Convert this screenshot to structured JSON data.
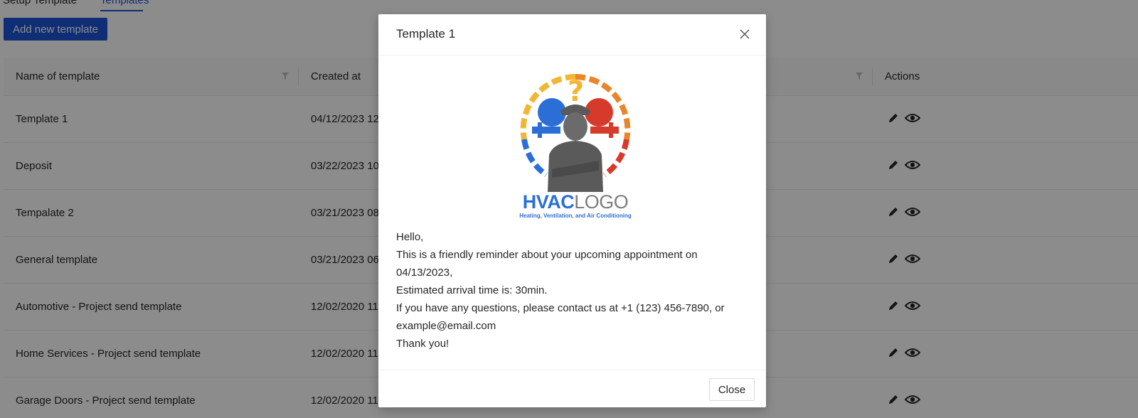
{
  "tabs": [
    {
      "label": "Setup Template"
    },
    {
      "label": "Templates",
      "active": true
    }
  ],
  "toolbar": {
    "add_label": "Add new template"
  },
  "table": {
    "columns": {
      "name": "Name of template",
      "created": "Created at",
      "actions": "Actions"
    },
    "rows": [
      {
        "name": "Template 1",
        "created": "04/12/2023 12"
      },
      {
        "name": "Deposit",
        "created": "03/22/2023 10"
      },
      {
        "name": "Tempalate 2",
        "created": "03/21/2023 08"
      },
      {
        "name": "General template",
        "created": "03/21/2023 06"
      },
      {
        "name": "Automotive - Project send template",
        "created": "12/02/2020 11"
      },
      {
        "name": "Home Services - Project send template",
        "created": "12/02/2020 11"
      },
      {
        "name": "Garage Doors - Project send template",
        "created": "12/02/2020 11"
      }
    ],
    "row_icons": [
      "pencil-icon",
      "eye-icon"
    ]
  },
  "modal": {
    "title": "Template 1",
    "logo": {
      "main_bold": "HVAC",
      "main_light": "LOGO",
      "subtitle": "Heating, Ventilation, and Air Conditioning"
    },
    "message": [
      "Hello,",
      "This is a friendly reminder about your upcoming appointment on 04/13/2023,",
      "Estimated arrival time is: 30min.",
      "If you have any questions, please contact us at +1 (123) 456-7890, or example@email.com",
      "Thank you!"
    ],
    "close_label": "Close"
  },
  "colors": {
    "primary": "#1c54d6",
    "overlay": "rgba(0,0,0,0.45)",
    "logo_blue": "#2b6fd6",
    "logo_red": "#d63a2b",
    "logo_yellow": "#f2b632"
  }
}
